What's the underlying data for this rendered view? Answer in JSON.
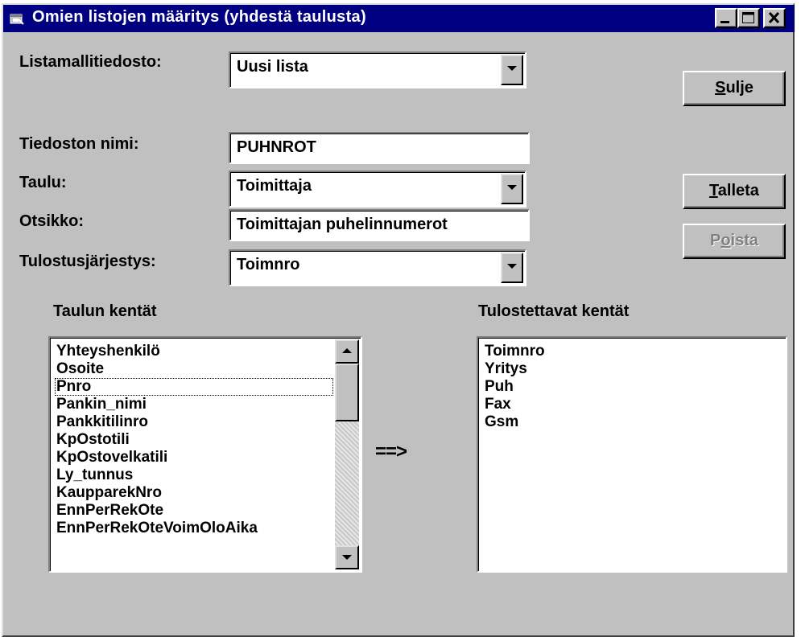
{
  "window": {
    "title": "Omien listojen määritys (yhdestä taulusta)",
    "icon": "app-window-icon",
    "controls": {
      "minimize": "minimize-icon",
      "maximize": "maximize-icon",
      "close": "close-icon"
    }
  },
  "form": {
    "template_label": "Listamallitiedosto:",
    "template_value": "Uusi lista",
    "filename_label": "Tiedoston nimi:",
    "filename_value": "PUHNROT",
    "table_label": "Taulu:",
    "table_value": "Toimittaja",
    "heading_label": "Otsikko:",
    "heading_value": "Toimittajan puhelinnumerot",
    "order_label": "Tulostusjärjestys:",
    "order_value": "Toimnro"
  },
  "buttons": {
    "close": {
      "pre": "",
      "accel": "S",
      "post": "ulje"
    },
    "save": {
      "pre": "",
      "accel": "T",
      "post": "alleta"
    },
    "delete": {
      "pre": "P",
      "accel": "o",
      "post": "ista",
      "disabled": true
    }
  },
  "lists": {
    "available_header": "Taulun kentät",
    "available_items": [
      "Yhteyshenkilö",
      "Osoite",
      "Pnro",
      "Pankin_nimi",
      "Pankkitilinro",
      "KpOstotili",
      "KpOstovelkatili",
      "Ly_tunnus",
      "KaupparekNro",
      "EnnPerRekOte",
      "EnnPerRekOteVoimOloAika"
    ],
    "focused_index": 2,
    "selected_header": "Tulostettavat kentät",
    "selected_items": [
      "Toimnro",
      "Yritys",
      "Puh",
      "Fax",
      "Gsm"
    ],
    "move_arrow": "==>"
  },
  "colors": {
    "title_bar": "#000080",
    "face": "#c0c0c0",
    "disabled_text": "#808080"
  }
}
